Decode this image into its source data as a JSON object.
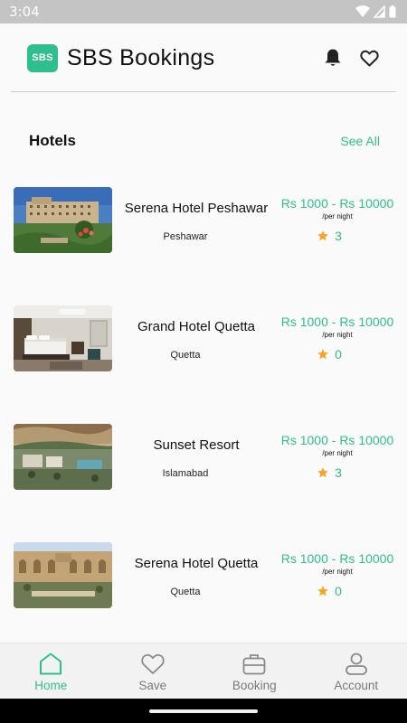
{
  "status_bar": {
    "time": "3:04",
    "icons": [
      "wifi-icon",
      "signal-icon",
      "battery-icon"
    ]
  },
  "header": {
    "logo_text": "SBS",
    "title": "SBS Bookings",
    "icons": [
      "bell-icon",
      "heart-icon"
    ]
  },
  "section": {
    "title": "Hotels",
    "see_all": "See All"
  },
  "colors": {
    "accent": "#2fbf8f",
    "star": "#f6a623",
    "nav_inactive": "#7a7a7a"
  },
  "hotels": [
    {
      "name": "Serena Hotel Peshawar",
      "city": "Peshawar",
      "price": "Rs 1000 - Rs 10000",
      "per_night": "/per night",
      "rating": "3"
    },
    {
      "name": "Grand Hotel Quetta",
      "city": "Quetta",
      "price": "Rs 1000 - Rs 10000",
      "per_night": "/per night",
      "rating": "0"
    },
    {
      "name": "Sunset Resort",
      "city": "Islamabad",
      "price": "Rs 1000 - Rs 10000",
      "per_night": "/per night",
      "rating": "3"
    },
    {
      "name": "Serena Hotel Quetta",
      "city": "Quetta",
      "price": "Rs 1000 - Rs 10000",
      "per_night": "/per night",
      "rating": "0"
    }
  ],
  "nav": {
    "items": [
      {
        "label": "Home",
        "icon": "home-icon",
        "active": true
      },
      {
        "label": "Save",
        "icon": "heart-outline-icon",
        "active": false
      },
      {
        "label": "Booking",
        "icon": "briefcase-icon",
        "active": false
      },
      {
        "label": "Account",
        "icon": "user-icon",
        "active": false
      }
    ]
  }
}
